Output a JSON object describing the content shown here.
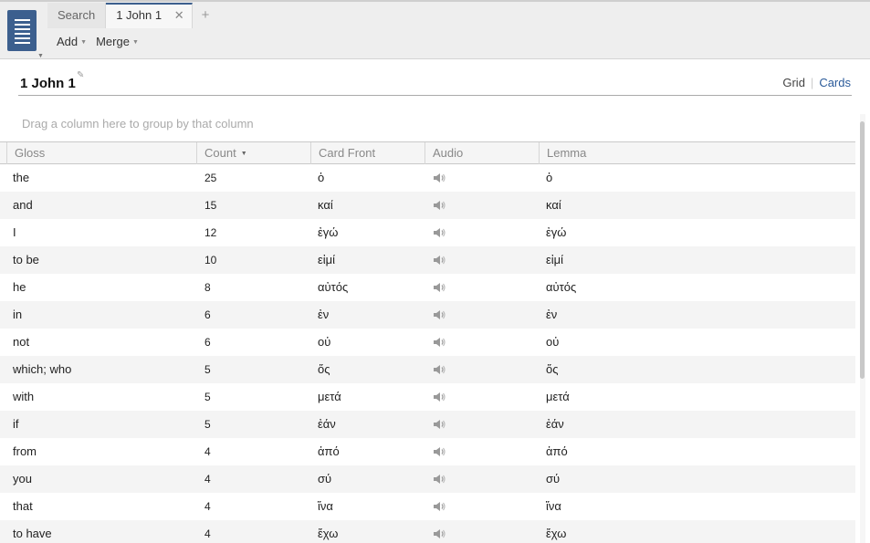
{
  "tabs": [
    {
      "label": "Search"
    },
    {
      "label": "1 John 1"
    }
  ],
  "toolbar": {
    "add_label": "Add",
    "merge_label": "Merge"
  },
  "document": {
    "title": "1 John 1"
  },
  "view_switch": {
    "grid_label": "Grid",
    "cards_label": "Cards",
    "selected": "Cards"
  },
  "group_hint": "Drag a column here to group by that column",
  "columns": [
    "Gloss",
    "Count",
    "Card Front",
    "Audio",
    "Lemma"
  ],
  "sorted_column": "Count",
  "rows": [
    {
      "gloss": "the",
      "count": "25",
      "front": "ὁ",
      "lemma": "ὁ"
    },
    {
      "gloss": "and",
      "count": "15",
      "front": "καί",
      "lemma": "καί"
    },
    {
      "gloss": "I",
      "count": "12",
      "front": "ἐγώ",
      "lemma": "ἐγώ"
    },
    {
      "gloss": "to be",
      "count": "10",
      "front": "εἰμί",
      "lemma": "εἰμί"
    },
    {
      "gloss": "he",
      "count": "8",
      "front": "αὐτός",
      "lemma": "αὐτός"
    },
    {
      "gloss": "in",
      "count": "6",
      "front": "ἐν",
      "lemma": "ἐν"
    },
    {
      "gloss": "not",
      "count": "6",
      "front": "οὐ",
      "lemma": "οὐ"
    },
    {
      "gloss": "which; who",
      "count": "5",
      "front": "ὅς",
      "lemma": "ὅς"
    },
    {
      "gloss": "with",
      "count": "5",
      "front": "μετά",
      "lemma": "μετά"
    },
    {
      "gloss": "if",
      "count": "5",
      "front": "ἐάν",
      "lemma": "ἐάν"
    },
    {
      "gloss": "from",
      "count": "4",
      "front": "ἀπό",
      "lemma": "ἀπό"
    },
    {
      "gloss": "you",
      "count": "4",
      "front": "σύ",
      "lemma": "σύ"
    },
    {
      "gloss": "that",
      "count": "4",
      "front": "ἵνα",
      "lemma": "ἵνα"
    },
    {
      "gloss": "to have",
      "count": "4",
      "front": "ἔχω",
      "lemma": "ἔχω"
    }
  ],
  "colors": {
    "accent": "#3c5f8e",
    "link": "#2b5b9a"
  },
  "icons": {
    "app_menu": "list-icon",
    "audio": "speaker-icon",
    "edit": "pencil-icon"
  }
}
